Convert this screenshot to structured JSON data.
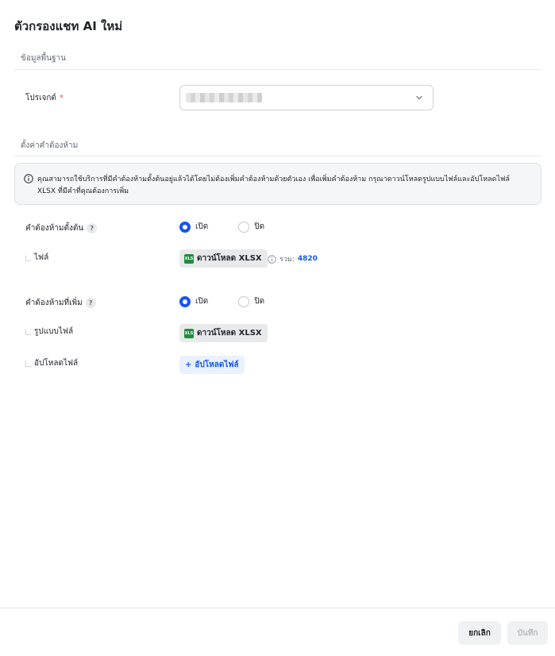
{
  "page": {
    "title": "ตัวกรองแชท AI ใหม่"
  },
  "sections": {
    "basic": "ข้อมูลพื้นฐาน",
    "forbidden": "ตั้งค่าคำต้องห้าม"
  },
  "project": {
    "label": "โปรเจกต์",
    "required_mark": "*"
  },
  "info": {
    "text": "คุณสามารถใช้บริการที่มีคำต้องห้ามตั้งต้นอยู่แล้วได้โดยไม่ต้องเพิ่มคำต้องห้ามด้วยตัวเอง เพื่อเพิ่มคำต้องห้าม กรุณาดาวน์โหลดรูปแบบไฟล์และอัปโหลดไฟล์ XLSX ที่มีคำที่คุณต้องการเพิ่ม"
  },
  "default_words": {
    "label": "คำต้องห้ามตั้งต้น",
    "help": "?",
    "on_label": "เปิด",
    "off_label": "ปิด",
    "selected": "on",
    "file_label": "ไฟล์",
    "download_label": "ดาวน์โหลด XLSX",
    "total_label": "รวม:",
    "total_value": "4820"
  },
  "added_words": {
    "label": "คำต้องห้ามที่เพิ่ม",
    "help": "?",
    "on_label": "เปิด",
    "off_label": "ปิด",
    "selected": "on",
    "format_label": "รูปแบบไฟล์",
    "download_label": "ดาวน์โหลด XLSX",
    "upload_label": "อัปโหลดไฟล์",
    "upload_button": "อัปโหลดไฟล์",
    "upload_plus": "+"
  },
  "footer": {
    "cancel": "ยกเลิก",
    "save": "บันทึก"
  },
  "colors": {
    "accent": "#1456f0",
    "xlsx": "#1e8e3e",
    "required": "#f54a45"
  },
  "icons": {
    "info": "info-icon",
    "chevron": "chevron-down-icon",
    "xlsx": "xlsx-file-icon"
  }
}
